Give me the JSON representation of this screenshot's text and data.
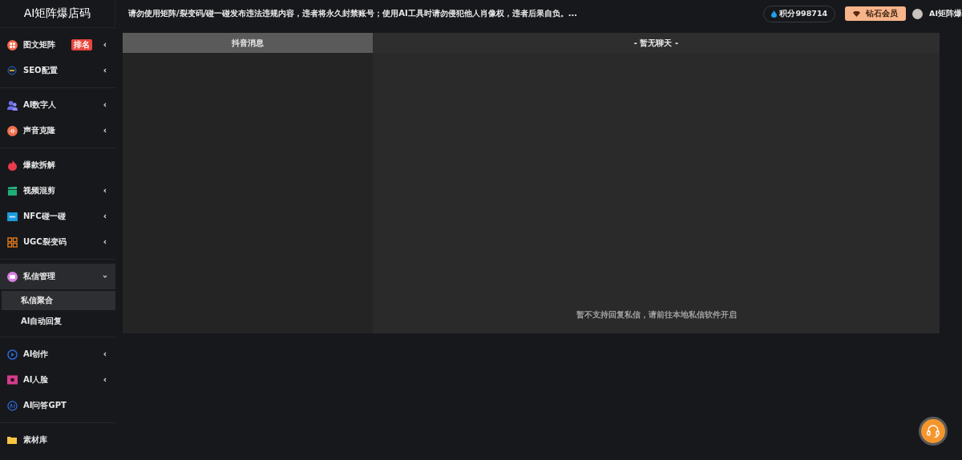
{
  "sidebar": {
    "logo": "AI矩阵爆店码",
    "groups": [
      {
        "items": [
          {
            "label": "图文矩阵",
            "kind": "folder",
            "expanded": false,
            "selected": false,
            "badge": "排名"
          },
          {
            "label": "SEO配置",
            "kind": "folder",
            "expanded": false,
            "selected": false
          }
        ]
      },
      {
        "items": [
          {
            "label": "AI数字人",
            "kind": "folder",
            "expanded": false,
            "selected": false
          },
          {
            "label": "声音克隆",
            "kind": "folder",
            "expanded": false,
            "selected": false
          }
        ]
      },
      {
        "items": [
          {
            "label": "爆款拆解",
            "kind": "link",
            "selected": false
          },
          {
            "label": "视频混剪",
            "kind": "folder",
            "expanded": false,
            "selected": false
          },
          {
            "label": "NFC碰一碰",
            "kind": "folder",
            "expanded": false,
            "selected": false
          },
          {
            "label": "UGC裂变码",
            "kind": "folder",
            "expanded": false,
            "selected": false
          }
        ]
      },
      {
        "items": [
          {
            "label": "私信管理",
            "kind": "folder",
            "expanded": true,
            "selected": true,
            "children": [
              {
                "label": "私信聚合",
                "selected": true
              },
              {
                "label": "AI自动回复",
                "selected": false
              }
            ]
          }
        ]
      },
      {
        "items": [
          {
            "label": "AI创作",
            "kind": "folder",
            "expanded": false,
            "selected": false
          },
          {
            "label": "AI人脸",
            "kind": "folder",
            "expanded": false,
            "selected": false
          },
          {
            "label": "AI问答GPT",
            "kind": "link",
            "selected": false
          }
        ]
      },
      {
        "items": [
          {
            "label": "素材库",
            "kind": "link",
            "selected": false
          }
        ]
      }
    ]
  },
  "header": {
    "notice": "请勿使用矩阵/裂变码/碰一碰发布违法违规内容，违者将永久封禁账号；使用AI工具时请勿侵犯他人肖像权，违者后果自负。...",
    "points": "积分998714",
    "vip_button": "钻石会员",
    "username": "AI矩阵爆"
  },
  "chat": {
    "list_title": "抖音消息",
    "conversation_title": "- 暂无聊天 -",
    "note": "暂不支持回复私信，请前往本地私信软件开启"
  }
}
